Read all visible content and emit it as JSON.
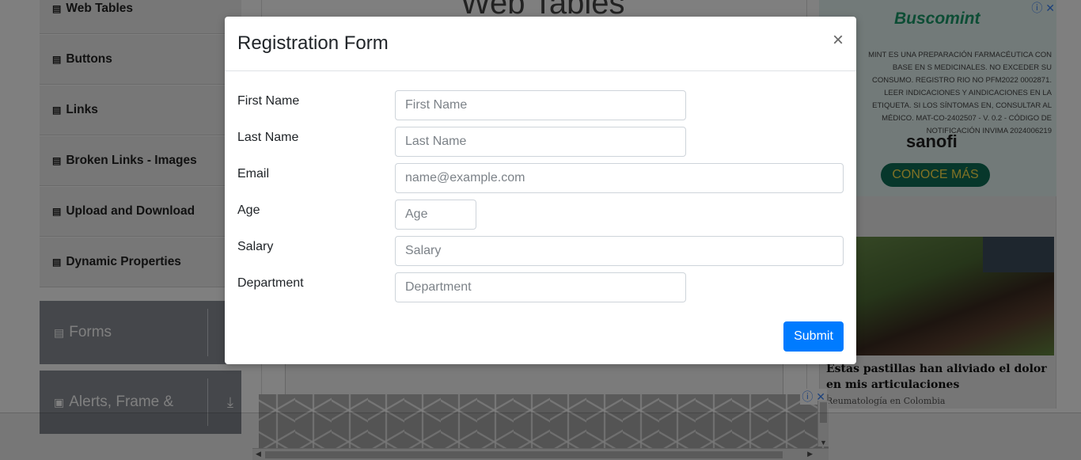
{
  "sidebar": {
    "items": [
      {
        "label": "Web Tables"
      },
      {
        "label": "Buttons"
      },
      {
        "label": "Links"
      },
      {
        "label": "Broken Links - Images"
      },
      {
        "label": "Upload and Download"
      },
      {
        "label": "Dynamic Properties"
      }
    ],
    "groups": [
      {
        "label": "Forms"
      },
      {
        "label": "Alerts, Frame &"
      }
    ]
  },
  "page": {
    "title": "Web Tables"
  },
  "ads": {
    "top": {
      "brand": "Buscomint",
      "disclaimer": "MINT ES UNA PREPARACIÓN FARMACÉUTICA CON BASE EN S MEDICINALES. NO EXCEDER SU CONSUMO. REGISTRO RIO NO PFM2022 0002871. LEER INDICACIONES Y AINDICACIONES EN LA ETIQUETA. SI LOS SÍNTOMAS EN, CONSULTAR AL MÉDICO. MAT-CO-2402507 - V. 0.2 - CÓDIGO DE NOTIFICACIÓN INVIMA 2024006219",
      "sponsor": "sanofi",
      "cta": "CONOCE MÁS"
    },
    "side": {
      "headline": "Estas pastillas han aliviado el dolor en mis articulaciones",
      "source": "Reumatología en Colombia"
    }
  },
  "modal": {
    "title": "Registration Form",
    "close": "×",
    "fields": [
      {
        "label": "First Name",
        "placeholder": "First Name"
      },
      {
        "label": "Last Name",
        "placeholder": "Last Name"
      },
      {
        "label": "Email",
        "placeholder": "name@example.com"
      },
      {
        "label": "Age",
        "placeholder": "Age"
      },
      {
        "label": "Salary",
        "placeholder": "Salary"
      },
      {
        "label": "Department",
        "placeholder": "Department"
      }
    ],
    "submit": "Submit"
  },
  "colors": {
    "primary": "#007bff",
    "overlay": "rgba(0,0,0,0.5)"
  }
}
